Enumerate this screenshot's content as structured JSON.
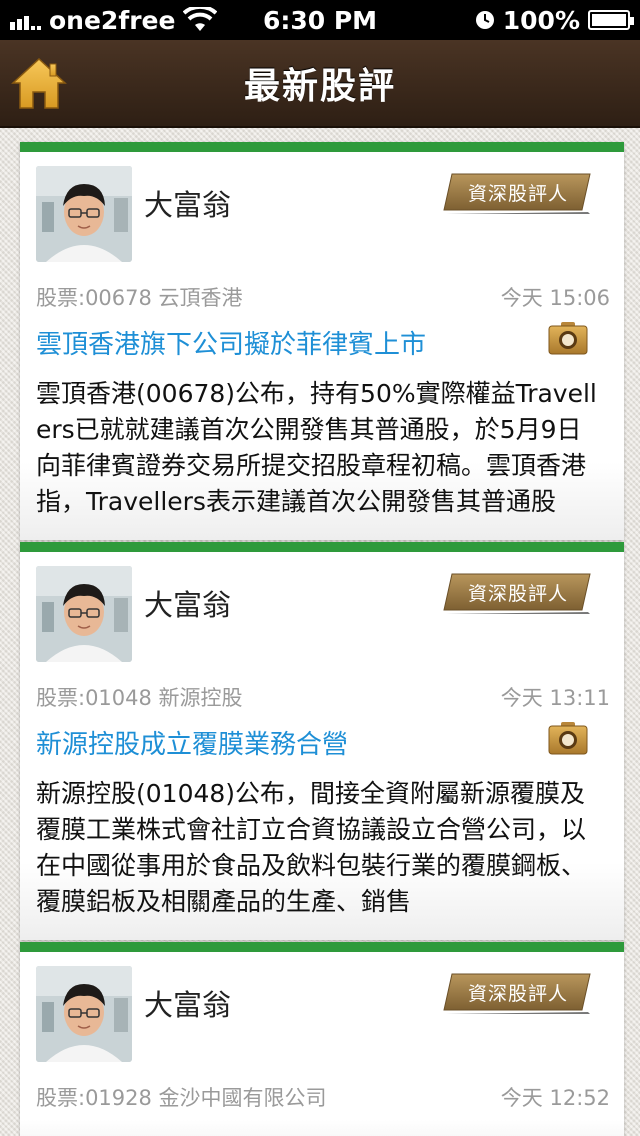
{
  "status_bar": {
    "carrier": "one2free",
    "time": "6:30 PM",
    "battery": "100%"
  },
  "nav": {
    "title": "最新股評",
    "home_icon": "home-icon"
  },
  "colors": {
    "accent_green": "#2e9a3b",
    "link_blue": "#1e8fd6",
    "nav_brown": "#3b2a1c",
    "badge_gold": "#9c7c46"
  },
  "posts": [
    {
      "author": "大富翁",
      "badge": "資深股評人",
      "stock": "股票:00678 云頂香港",
      "time": "今天 15:06",
      "headline": "雲頂香港旗下公司擬於菲律賓上市",
      "body": "雲頂香港(00678)公布，持有50%實際權益Travellers已就就建議首次公開發售其普通股，於5月9日向菲律賓證券交易所提交招股章程初稿。雲頂香港指，Travellers表示建議首次公開發售其普通股"
    },
    {
      "author": "大富翁",
      "badge": "資深股評人",
      "stock": "股票:01048 新源控股",
      "time": "今天 13:11",
      "headline": "新源控股成立覆膜業務合營",
      "body": "新源控股(01048)公布，間接全資附屬新源覆膜及覆膜工業株式會社訂立合資協議設立合營公司，以在中國從事用於食品及飲料包裝行業的覆膜鋼板、覆膜鋁板及相關產品的生產、銷售"
    },
    {
      "author": "大富翁",
      "badge": "資深股評人",
      "stock": "股票:01928 金沙中國有限公司",
      "time": "今天 12:52",
      "headline": "",
      "body": ""
    }
  ]
}
